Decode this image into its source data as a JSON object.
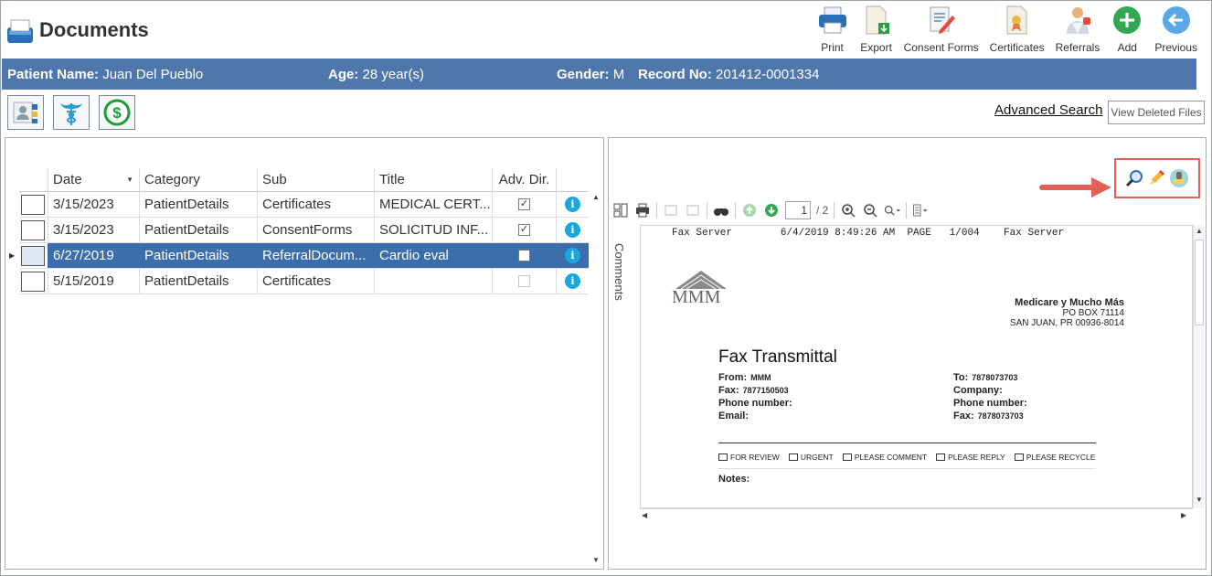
{
  "app": {
    "title": "Documents"
  },
  "toolbar": [
    {
      "id": "print",
      "label": "Print",
      "icon": "printer-icon"
    },
    {
      "id": "export",
      "label": "Export",
      "icon": "export-icon"
    },
    {
      "id": "consent",
      "label": "Consent Forms",
      "icon": "consent-forms-icon"
    },
    {
      "id": "certificates",
      "label": "Certificates",
      "icon": "certificate-icon"
    },
    {
      "id": "referrals",
      "label": "Referrals",
      "icon": "referrals-icon"
    },
    {
      "id": "add",
      "label": "Add",
      "icon": "add-icon"
    },
    {
      "id": "previous",
      "label": "Previous",
      "icon": "back-arrow-icon"
    }
  ],
  "patient": {
    "name_label": "Patient Name:",
    "name": "Juan Del Pueblo",
    "age_label": "Age:",
    "age": "28 year(s)",
    "gender_label": "Gender:",
    "gender": "M",
    "record_label": "Record No:",
    "record": "201412-0001334"
  },
  "actions": {
    "advanced_search": "Advanced Search",
    "view_deleted": "View Deleted Files"
  },
  "grid": {
    "columns": [
      "Date",
      "Category",
      "Sub",
      "Title",
      "Adv. Dir."
    ],
    "rows": [
      {
        "date": "3/15/2023",
        "category": "PatientDetails",
        "sub": "Certificates",
        "title": "MEDICAL CERT...",
        "adv": true,
        "selected": false
      },
      {
        "date": "3/15/2023",
        "category": "PatientDetails",
        "sub": "ConsentForms",
        "title": "SOLICITUD INF...",
        "adv": true,
        "selected": false
      },
      {
        "date": "6/27/2019",
        "category": "PatientDetails",
        "sub": "ReferralDocum...",
        "title": "Cardio eval",
        "adv": false,
        "selected": true
      },
      {
        "date": "5/15/2019",
        "category": "PatientDetails",
        "sub": "Certificates",
        "title": "",
        "adv": false,
        "selected": false
      }
    ]
  },
  "viewer": {
    "comments_label": "Comments",
    "page_current": "1",
    "page_total": "/ 2",
    "document": {
      "fax_header": "Fax Server        6/4/2019 8:49:26 AM  PAGE   1/004    Fax Server",
      "logo_text": "MMM",
      "company_name": "Medicare y Mucho Más",
      "company_address1": "PO BOX 71114",
      "company_address2": "SAN JUAN, PR 00936-8014",
      "title": "Fax Transmittal",
      "from_label": "From:",
      "from_value": "MMM",
      "fax_label": "Fax:",
      "fax_value": "7877150503",
      "phone_label": "Phone number:",
      "email_label": "Email:",
      "to_label": "To:",
      "to_value": "7878073703",
      "company_label": "Company:",
      "phone2_label": "Phone number:",
      "fax2_label": "Fax:",
      "fax2_value": "7878073703",
      "options": [
        "FOR REVIEW",
        "URGENT",
        "PLEASE COMMENT",
        "PLEASE REPLY",
        "PLEASE RECYCLE"
      ],
      "notes_label": "Notes:"
    }
  },
  "colors": {
    "patient_bar": "#5077ac",
    "selected_row": "#3b6eaa",
    "highlight": "#e2605a",
    "info": "#1ca6e0"
  }
}
